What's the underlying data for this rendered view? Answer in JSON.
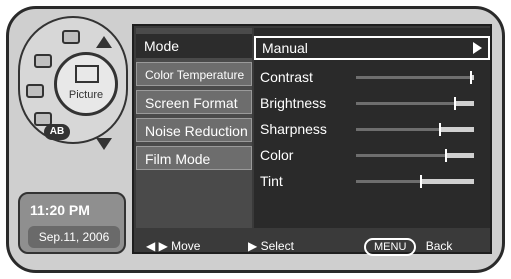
{
  "left_nav": {
    "active_label": "Picture",
    "ab_label": "AB",
    "icons": [
      "tv-icon",
      "speaker-icon",
      "antenna-icon",
      "channel-icon",
      "picture-icon"
    ]
  },
  "time": {
    "clock": "11:20 PM",
    "date": "Sep.11, 2006"
  },
  "menu": {
    "items": [
      "Mode",
      "Color Temperature",
      "Screen Format",
      "Noise Reduction",
      "Film Mode"
    ],
    "selected_index": 0
  },
  "mode": {
    "value": "Manual"
  },
  "settings": [
    {
      "label": "Contrast",
      "level": 0.98
    },
    {
      "label": "Brightness",
      "level": 0.84
    },
    {
      "label": "Sharpness",
      "level": 0.71
    },
    {
      "label": "Color",
      "level": 0.76
    },
    {
      "label": "Tint",
      "level": 0.55
    }
  ],
  "footer": {
    "move_label": "Move",
    "select_label": "Select",
    "menu_button": "MENU",
    "back_label": "Back"
  }
}
